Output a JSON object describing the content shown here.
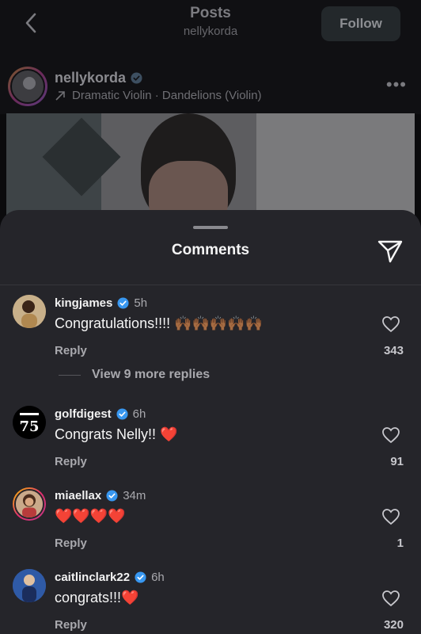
{
  "header": {
    "title": "Posts",
    "subtitle": "nellykorda",
    "follow_label": "Follow"
  },
  "post": {
    "username": "nellykorda",
    "audio": "Dramatic Violin · Dandelions (Violin)"
  },
  "sheet": {
    "title": "Comments"
  },
  "comments": [
    {
      "user": "kingjames",
      "time": "5h",
      "text": "Congratulations!!!! 🙌🏾🙌🏾🙌🏾🙌🏾🙌🏾",
      "reply": "Reply",
      "likes": "343"
    },
    {
      "user": "golfdigest",
      "time": "6h",
      "text": "Congrats Nelly!! ❤️",
      "reply": "Reply",
      "likes": "91"
    },
    {
      "user": "miaellax",
      "time": "34m",
      "text": "❤️❤️❤️❤️",
      "reply": "Reply",
      "likes": "1"
    },
    {
      "user": "caitlinclark22",
      "time": "6h",
      "text": "congrats!!!❤️",
      "reply": "Reply",
      "likes": "320"
    }
  ],
  "more_replies": "View 9 more replies",
  "colors": {
    "verified": "#3897f0",
    "accent_heart": "#ff3040"
  }
}
